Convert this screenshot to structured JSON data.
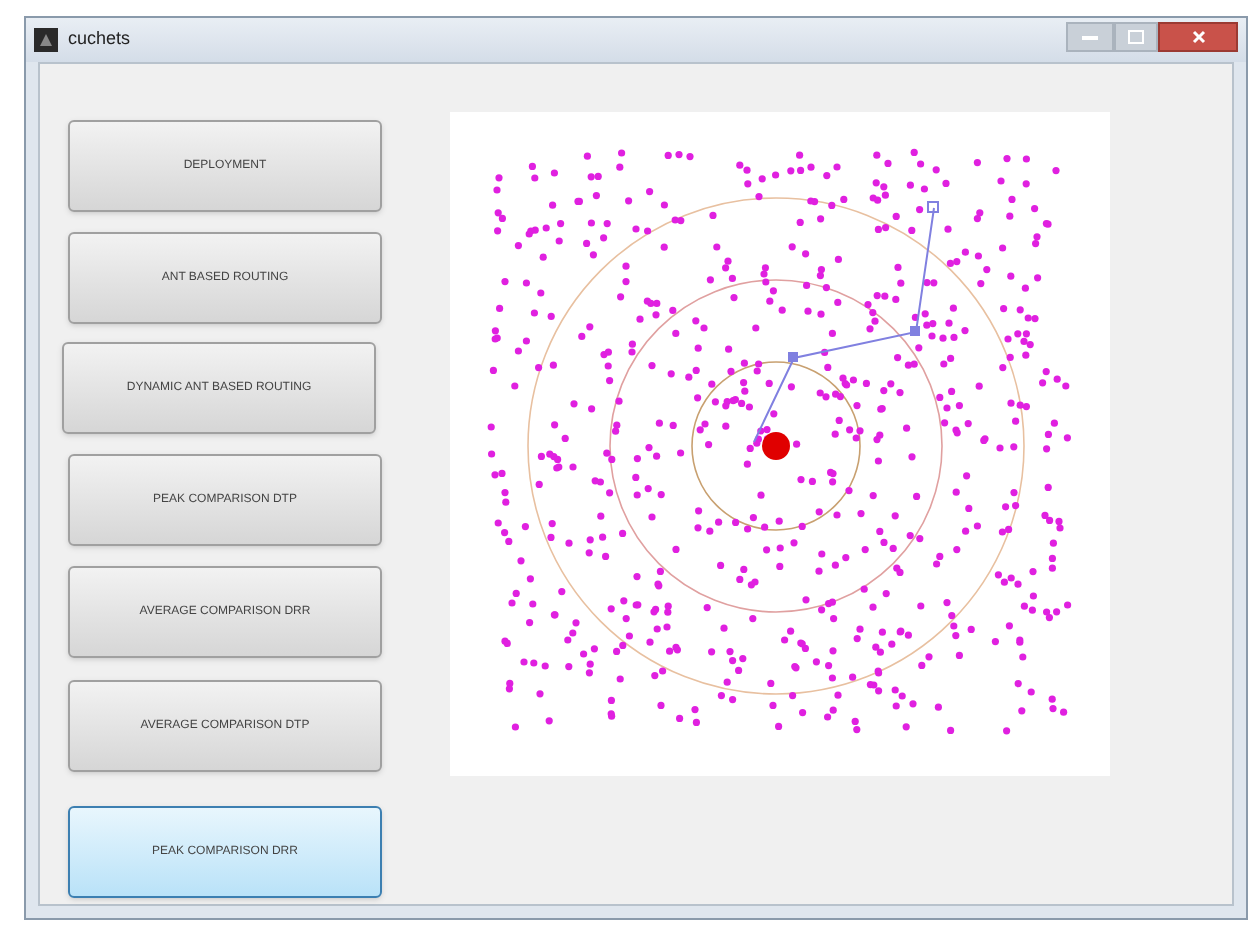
{
  "window": {
    "title": "cuchets"
  },
  "buttons": [
    {
      "label": "DEPLOYMENT",
      "selected": false
    },
    {
      "label": "ANT BASED ROUTING",
      "selected": false
    },
    {
      "label": "DYNAMIC ANT BASED ROUTING",
      "selected": false
    },
    {
      "label": "PEAK COMPARISON DTP",
      "selected": false
    },
    {
      "label": "AVERAGE COMPARISON DRR",
      "selected": false
    },
    {
      "label": "AVERAGE COMPARISON DTP",
      "selected": false
    },
    {
      "label": "PEAK COMPARISON DRR",
      "selected": true
    }
  ]
}
